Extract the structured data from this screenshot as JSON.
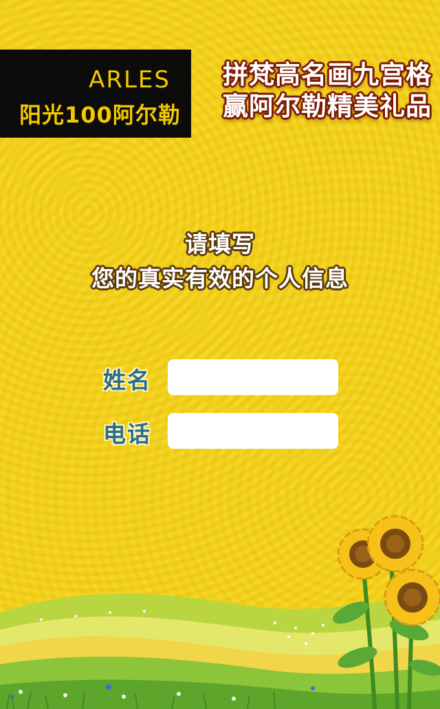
{
  "logo": {
    "en": "ARLES",
    "cn": "阳光100阿尔勒"
  },
  "banner": {
    "line1": "拼梵高名画九宫格",
    "line2": "赢阿尔勒精美礼品"
  },
  "heading": {
    "line1": "请填写",
    "line2": "您的真实有效的个人信息"
  },
  "form": {
    "name_label": "姓名",
    "name_value": "",
    "phone_label": "电话",
    "phone_value": ""
  },
  "colors": {
    "background": "#f6d215",
    "logo_box": "#0c0c0a",
    "logo_text": "#f3c800",
    "label_text": "#2a6c8a"
  }
}
